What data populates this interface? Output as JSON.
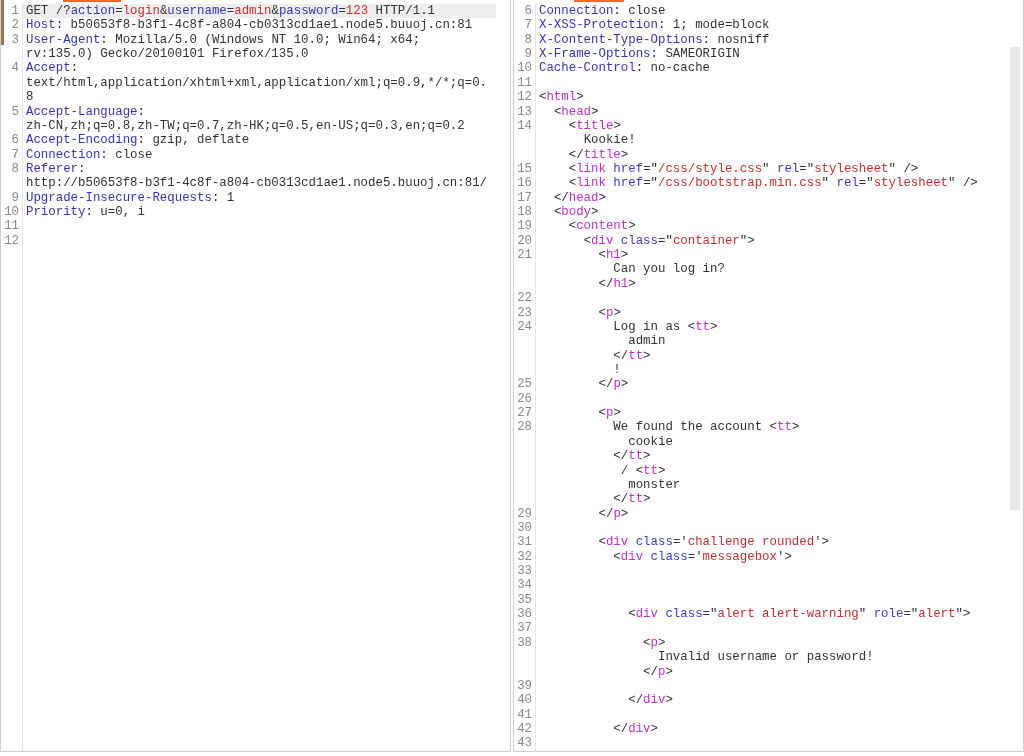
{
  "request": {
    "lines": [
      {
        "number": "1",
        "current": true,
        "rows": [
          {
            "tokens": [
              {
                "kind": "plain",
                "text": "GET /?"
              },
              {
                "kind": "key",
                "text": "action"
              },
              {
                "kind": "plain",
                "text": "="
              },
              {
                "kind": "value",
                "text": "login"
              },
              {
                "kind": "plain",
                "text": "&"
              },
              {
                "kind": "key",
                "text": "username"
              },
              {
                "kind": "plain",
                "text": "="
              },
              {
                "kind": "value",
                "text": "admin"
              },
              {
                "kind": "plain",
                "text": "&"
              },
              {
                "kind": "key",
                "text": "password"
              },
              {
                "kind": "plain",
                "text": "="
              },
              {
                "kind": "value",
                "text": "123"
              },
              {
                "kind": "plain",
                "text": " HTTP/1.1"
              }
            ]
          }
        ]
      },
      {
        "number": "2",
        "current": false,
        "rows": [
          {
            "tokens": [
              {
                "kind": "key",
                "text": "Host"
              },
              {
                "kind": "plain",
                "text": ": b50653f8-b3f1-4c8f-a804-cb0313cd1ae1.node5.buuoj.cn:81"
              }
            ]
          }
        ]
      },
      {
        "number": "3",
        "current": false,
        "rows": [
          {
            "tokens": [
              {
                "kind": "key",
                "text": "User-Agent"
              },
              {
                "kind": "plain",
                "text": ": Mozilla/5.0 (Windows NT 10.0; Win64; x64;"
              }
            ]
          },
          {
            "tokens": [
              {
                "kind": "plain",
                "text": "rv:135.0) Gecko/20100101 Firefox/135.0"
              }
            ]
          }
        ]
      },
      {
        "number": "4",
        "current": false,
        "rows": [
          {
            "tokens": [
              {
                "kind": "key",
                "text": "Accept"
              },
              {
                "kind": "plain",
                "text": ":"
              }
            ]
          },
          {
            "tokens": [
              {
                "kind": "plain",
                "text": "text/html,application/xhtml+xml,application/xml;q=0.9,*/*;q=0."
              }
            ]
          },
          {
            "tokens": [
              {
                "kind": "plain",
                "text": "8"
              }
            ]
          }
        ]
      },
      {
        "number": "5",
        "current": false,
        "rows": [
          {
            "tokens": [
              {
                "kind": "key",
                "text": "Accept-Language"
              },
              {
                "kind": "plain",
                "text": ":"
              }
            ]
          },
          {
            "tokens": [
              {
                "kind": "plain",
                "text": "zh-CN,zh;q=0.8,zh-TW;q=0.7,zh-HK;q=0.5,en-US;q=0.3,en;q=0.2"
              }
            ]
          }
        ]
      },
      {
        "number": "6",
        "current": false,
        "rows": [
          {
            "tokens": [
              {
                "kind": "key",
                "text": "Accept-Encoding"
              },
              {
                "kind": "plain",
                "text": ": gzip, deflate"
              }
            ]
          }
        ]
      },
      {
        "number": "7",
        "current": false,
        "rows": [
          {
            "tokens": [
              {
                "kind": "key",
                "text": "Connection"
              },
              {
                "kind": "plain",
                "text": ": close"
              }
            ]
          }
        ]
      },
      {
        "number": "8",
        "current": false,
        "rows": [
          {
            "tokens": [
              {
                "kind": "key",
                "text": "Referer"
              },
              {
                "kind": "plain",
                "text": ":"
              }
            ]
          },
          {
            "tokens": [
              {
                "kind": "plain",
                "text": "http://b50653f8-b3f1-4c8f-a804-cb0313cd1ae1.node5.buuoj.cn:81/"
              }
            ]
          }
        ]
      },
      {
        "number": "9",
        "current": false,
        "rows": [
          {
            "tokens": [
              {
                "kind": "key",
                "text": "Upgrade-Insecure-Requests"
              },
              {
                "kind": "plain",
                "text": ": 1"
              }
            ]
          }
        ]
      },
      {
        "number": "10",
        "current": false,
        "rows": [
          {
            "tokens": [
              {
                "kind": "key",
                "text": "Priority"
              },
              {
                "kind": "plain",
                "text": ": u=0, i"
              }
            ]
          }
        ]
      },
      {
        "number": "11",
        "current": false
      },
      {
        "number": "12",
        "current": false
      }
    ]
  },
  "response": {
    "lines": [
      {
        "number": "6",
        "current": false,
        "rows": [
          {
            "tokens": [
              {
                "kind": "key",
                "text": "Connection"
              },
              {
                "kind": "plain",
                "text": ": close"
              }
            ]
          }
        ]
      },
      {
        "number": "7",
        "current": false,
        "rows": [
          {
            "tokens": [
              {
                "kind": "key",
                "text": "X-XSS-Protection"
              },
              {
                "kind": "plain",
                "text": ": 1; mode=block"
              }
            ]
          }
        ]
      },
      {
        "number": "8",
        "current": false,
        "rows": [
          {
            "tokens": [
              {
                "kind": "key",
                "text": "X-Content-Type-Options"
              },
              {
                "kind": "plain",
                "text": ": nosniff"
              }
            ]
          }
        ]
      },
      {
        "number": "9",
        "current": false,
        "rows": [
          {
            "tokens": [
              {
                "kind": "key",
                "text": "X-Frame-Options"
              },
              {
                "kind": "plain",
                "text": ": SAMEORIGIN"
              }
            ]
          }
        ]
      },
      {
        "number": "10",
        "current": false,
        "rows": [
          {
            "tokens": [
              {
                "kind": "key",
                "text": "Cache-Control"
              },
              {
                "kind": "plain",
                "text": ": no-cache"
              }
            ]
          }
        ]
      },
      {
        "number": "11",
        "current": false
      },
      {
        "number": "12",
        "current": false,
        "rows": [
          {
            "tokens": [
              {
                "kind": "plain",
                "text": "<"
              },
              {
                "kind": "tag",
                "text": "html"
              },
              {
                "kind": "plain",
                "text": ">"
              }
            ]
          }
        ]
      },
      {
        "number": "13",
        "current": false,
        "rows": [
          {
            "tokens": [
              {
                "kind": "plain",
                "text": "  <"
              },
              {
                "kind": "tag",
                "text": "head"
              },
              {
                "kind": "plain",
                "text": ">"
              }
            ]
          }
        ]
      },
      {
        "number": "14",
        "current": false,
        "rows": [
          {
            "tokens": [
              {
                "kind": "plain",
                "text": "    <"
              },
              {
                "kind": "tag",
                "text": "title"
              },
              {
                "kind": "plain",
                "text": ">"
              }
            ]
          },
          {
            "tokens": [
              {
                "kind": "plain",
                "text": "      Kookie!"
              }
            ]
          },
          {
            "tokens": [
              {
                "kind": "plain",
                "text": "    </"
              },
              {
                "kind": "tag",
                "text": "title"
              },
              {
                "kind": "plain",
                "text": ">"
              }
            ]
          }
        ]
      },
      {
        "number": "15",
        "current": false,
        "rows": [
          {
            "tokens": [
              {
                "kind": "plain",
                "text": "    <"
              },
              {
                "kind": "tag",
                "text": "link"
              },
              {
                "kind": "attr",
                "text": " href"
              },
              {
                "kind": "plain",
                "text": "=\""
              },
              {
                "kind": "string",
                "text": "/css/style.css"
              },
              {
                "kind": "plain",
                "text": "\" "
              },
              {
                "kind": "attr",
                "text": "rel"
              },
              {
                "kind": "plain",
                "text": "=\""
              },
              {
                "kind": "string",
                "text": "stylesheet"
              },
              {
                "kind": "plain",
                "text": "\" />"
              }
            ]
          }
        ]
      },
      {
        "number": "16",
        "current": false,
        "rows": [
          {
            "tokens": [
              {
                "kind": "plain",
                "text": "    <"
              },
              {
                "kind": "tag",
                "text": "link"
              },
              {
                "kind": "attr",
                "text": " href"
              },
              {
                "kind": "plain",
                "text": "=\""
              },
              {
                "kind": "string",
                "text": "/css/bootstrap.min.css"
              },
              {
                "kind": "plain",
                "text": "\" "
              },
              {
                "kind": "attr",
                "text": "rel"
              },
              {
                "kind": "plain",
                "text": "=\""
              },
              {
                "kind": "string",
                "text": "stylesheet"
              },
              {
                "kind": "plain",
                "text": "\" />"
              }
            ]
          }
        ]
      },
      {
        "number": "17",
        "current": false,
        "rows": [
          {
            "tokens": [
              {
                "kind": "plain",
                "text": "  </"
              },
              {
                "kind": "tag",
                "text": "head"
              },
              {
                "kind": "plain",
                "text": ">"
              }
            ]
          }
        ]
      },
      {
        "number": "18",
        "current": false,
        "rows": [
          {
            "tokens": [
              {
                "kind": "plain",
                "text": "  <"
              },
              {
                "kind": "tag",
                "text": "body"
              },
              {
                "kind": "plain",
                "text": ">"
              }
            ]
          }
        ]
      },
      {
        "number": "19",
        "current": false,
        "rows": [
          {
            "tokens": [
              {
                "kind": "plain",
                "text": "    <"
              },
              {
                "kind": "tag",
                "text": "content"
              },
              {
                "kind": "plain",
                "text": ">"
              }
            ]
          }
        ]
      },
      {
        "number": "20",
        "current": false,
        "rows": [
          {
            "tokens": [
              {
                "kind": "plain",
                "text": "      <"
              },
              {
                "kind": "tag",
                "text": "div"
              },
              {
                "kind": "attr",
                "text": " class"
              },
              {
                "kind": "plain",
                "text": "=\""
              },
              {
                "kind": "string",
                "text": "container"
              },
              {
                "kind": "plain",
                "text": "\">"
              }
            ]
          }
        ]
      },
      {
        "number": "21",
        "current": false,
        "rows": [
          {
            "tokens": [
              {
                "kind": "plain",
                "text": "        <"
              },
              {
                "kind": "tag",
                "text": "h1"
              },
              {
                "kind": "plain",
                "text": ">"
              }
            ]
          },
          {
            "tokens": [
              {
                "kind": "plain",
                "text": "          Can you log in?"
              }
            ]
          },
          {
            "tokens": [
              {
                "kind": "plain",
                "text": "        </"
              },
              {
                "kind": "tag",
                "text": "h1"
              },
              {
                "kind": "plain",
                "text": ">"
              }
            ]
          }
        ]
      },
      {
        "number": "22",
        "current": false
      },
      {
        "number": "23",
        "current": false,
        "rows": [
          {
            "tokens": [
              {
                "kind": "plain",
                "text": "        <"
              },
              {
                "kind": "tag",
                "text": "p"
              },
              {
                "kind": "plain",
                "text": ">"
              }
            ]
          }
        ]
      },
      {
        "number": "24",
        "current": false,
        "rows": [
          {
            "tokens": [
              {
                "kind": "plain",
                "text": "          Log in as <"
              },
              {
                "kind": "tag",
                "text": "tt"
              },
              {
                "kind": "plain",
                "text": ">"
              }
            ]
          },
          {
            "tokens": [
              {
                "kind": "plain",
                "text": "            admin"
              }
            ]
          },
          {
            "tokens": [
              {
                "kind": "plain",
                "text": "          </"
              },
              {
                "kind": "tag",
                "text": "tt"
              },
              {
                "kind": "plain",
                "text": ">"
              }
            ]
          },
          {
            "tokens": [
              {
                "kind": "plain",
                "text": "          !"
              }
            ]
          }
        ]
      },
      {
        "number": "25",
        "current": false,
        "rows": [
          {
            "tokens": [
              {
                "kind": "plain",
                "text": "        </"
              },
              {
                "kind": "tag",
                "text": "p"
              },
              {
                "kind": "plain",
                "text": ">"
              }
            ]
          }
        ]
      },
      {
        "number": "26",
        "current": false
      },
      {
        "number": "27",
        "current": false,
        "rows": [
          {
            "tokens": [
              {
                "kind": "plain",
                "text": "        <"
              },
              {
                "kind": "tag",
                "text": "p"
              },
              {
                "kind": "plain",
                "text": ">"
              }
            ]
          }
        ]
      },
      {
        "number": "28",
        "current": false,
        "rows": [
          {
            "tokens": [
              {
                "kind": "plain",
                "text": "          We found the account <"
              },
              {
                "kind": "tag",
                "text": "tt"
              },
              {
                "kind": "plain",
                "text": ">"
              }
            ]
          },
          {
            "tokens": [
              {
                "kind": "plain",
                "text": "            cookie"
              }
            ]
          },
          {
            "tokens": [
              {
                "kind": "plain",
                "text": "          </"
              },
              {
                "kind": "tag",
                "text": "tt"
              },
              {
                "kind": "plain",
                "text": ">"
              }
            ]
          },
          {
            "tokens": [
              {
                "kind": "plain",
                "text": "           / <"
              },
              {
                "kind": "tag",
                "text": "tt"
              },
              {
                "kind": "plain",
                "text": ">"
              }
            ]
          },
          {
            "tokens": [
              {
                "kind": "plain",
                "text": "            monster"
              }
            ]
          },
          {
            "tokens": [
              {
                "kind": "plain",
                "text": "          </"
              },
              {
                "kind": "tag",
                "text": "tt"
              },
              {
                "kind": "plain",
                "text": ">"
              }
            ]
          }
        ]
      },
      {
        "number": "29",
        "current": false,
        "rows": [
          {
            "tokens": [
              {
                "kind": "plain",
                "text": "        </"
              },
              {
                "kind": "tag",
                "text": "p"
              },
              {
                "kind": "plain",
                "text": ">"
              }
            ]
          }
        ]
      },
      {
        "number": "30",
        "current": false
      },
      {
        "number": "31",
        "current": false,
        "rows": [
          {
            "tokens": [
              {
                "kind": "plain",
                "text": "        <"
              },
              {
                "kind": "tag",
                "text": "div"
              },
              {
                "kind": "attr",
                "text": " class"
              },
              {
                "kind": "plain",
                "text": "='"
              },
              {
                "kind": "string",
                "text": "challenge rounded"
              },
              {
                "kind": "plain",
                "text": "'>"
              }
            ]
          }
        ]
      },
      {
        "number": "32",
        "current": false,
        "rows": [
          {
            "tokens": [
              {
                "kind": "plain",
                "text": "          <"
              },
              {
                "kind": "tag",
                "text": "div"
              },
              {
                "kind": "attr",
                "text": " class"
              },
              {
                "kind": "plain",
                "text": "='"
              },
              {
                "kind": "string",
                "text": "messagebox"
              },
              {
                "kind": "plain",
                "text": "'>"
              }
            ]
          }
        ]
      },
      {
        "number": "33",
        "current": false
      },
      {
        "number": "34",
        "current": false
      },
      {
        "number": "35",
        "current": false
      },
      {
        "number": "36",
        "current": false,
        "rows": [
          {
            "tokens": [
              {
                "kind": "plain",
                "text": "            <"
              },
              {
                "kind": "tag",
                "text": "div"
              },
              {
                "kind": "attr",
                "text": " class"
              },
              {
                "kind": "plain",
                "text": "=\""
              },
              {
                "kind": "string",
                "text": "alert alert-warning"
              },
              {
                "kind": "plain",
                "text": "\" "
              },
              {
                "kind": "attr",
                "text": "role"
              },
              {
                "kind": "plain",
                "text": "=\""
              },
              {
                "kind": "string",
                "text": "alert"
              },
              {
                "kind": "plain",
                "text": "\">"
              }
            ]
          }
        ]
      },
      {
        "number": "37",
        "current": false
      },
      {
        "number": "38",
        "current": false,
        "rows": [
          {
            "tokens": [
              {
                "kind": "plain",
                "text": "              <"
              },
              {
                "kind": "tag",
                "text": "p"
              },
              {
                "kind": "plain",
                "text": ">"
              }
            ]
          },
          {
            "tokens": [
              {
                "kind": "plain",
                "text": "                Invalid username or password!"
              }
            ]
          },
          {
            "tokens": [
              {
                "kind": "plain",
                "text": "              </"
              },
              {
                "kind": "tag",
                "text": "p"
              },
              {
                "kind": "plain",
                "text": ">"
              }
            ]
          }
        ]
      },
      {
        "number": "39",
        "current": false
      },
      {
        "number": "40",
        "current": false,
        "rows": [
          {
            "tokens": [
              {
                "kind": "plain",
                "text": "            </"
              },
              {
                "kind": "tag",
                "text": "div"
              },
              {
                "kind": "plain",
                "text": ">"
              }
            ]
          }
        ]
      },
      {
        "number": "41",
        "current": false
      },
      {
        "number": "42",
        "current": false,
        "rows": [
          {
            "tokens": [
              {
                "kind": "plain",
                "text": "          </"
              },
              {
                "kind": "tag",
                "text": "div"
              },
              {
                "kind": "plain",
                "text": ">"
              }
            ]
          }
        ]
      },
      {
        "number": "43",
        "current": false
      }
    ]
  }
}
